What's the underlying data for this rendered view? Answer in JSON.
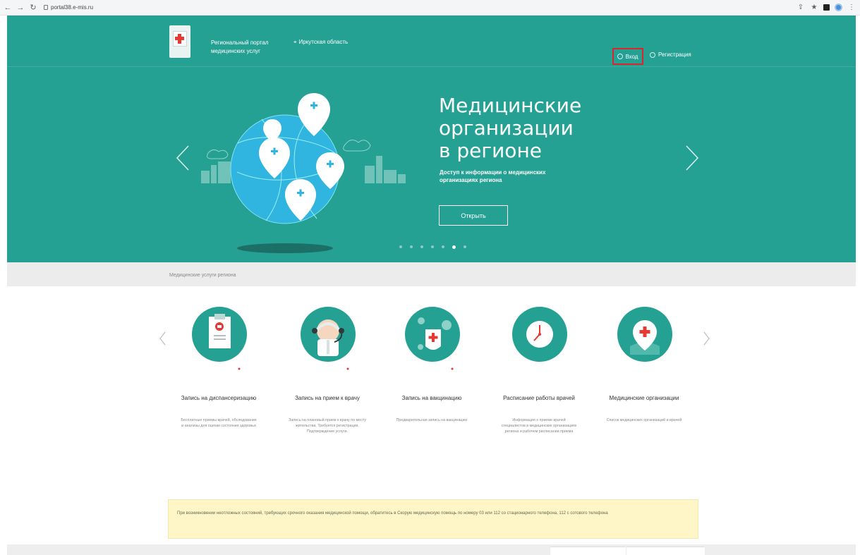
{
  "browser": {
    "url": "portal38.e-mis.ru",
    "icons": {
      "back": "back-arrow-icon",
      "forward": "forward-arrow-icon",
      "reload": "reload-icon",
      "lock": "lock-icon",
      "share": "share-icon",
      "bookmark": "star-icon",
      "extension": "extension-square-icon",
      "profile": "profile-avatar-icon"
    }
  },
  "header": {
    "portal_title": "Региональный портал медицинских услуг",
    "region": "Иркутская область",
    "login_label": "Вход",
    "register_label": "Регистрация"
  },
  "hero": {
    "title_line1": "Медицинские",
    "title_line2": "организации",
    "title_line3": "в регионе",
    "description": "Доступ к информации о медицинских организациях региона",
    "open_button": "Открыть",
    "slide_count": 7,
    "active_slide": 6
  },
  "services": {
    "section_label": "Медицинские услуги региона",
    "cards": [
      {
        "title": "Запись на диспансеризацию",
        "description": "Бесплатные приемы врачей, обследования и анализы для оценки состояния здоровья"
      },
      {
        "title": "Запись на прием к врачу",
        "description": "Запись на плановый прием к врачу по месту жительства. Требуется регистрация. Подтверждение услуги."
      },
      {
        "title": "Запись на вакцинацию",
        "description": "Предварительная запись на вакцинацию"
      },
      {
        "title": "Расписание работы врачей",
        "description": "Информация о приеме врачей специалистов в медицинских организациях региона и рабочем расписании приема"
      },
      {
        "title": "Медицинские организации",
        "description": "Список медицинских организаций и врачей"
      }
    ]
  },
  "warning": {
    "text": "При возникновении неотложных состояний, требующих срочного оказания медицинской помощи, обратитесь в Скорую медицинскую помощь по номеру 03 или 112 со стационарного телефона, 112 с сотового телефона"
  },
  "colors": {
    "hero_bg": "#25a194",
    "accent_red": "#d9262c",
    "warning_bg": "#fff6c8"
  }
}
